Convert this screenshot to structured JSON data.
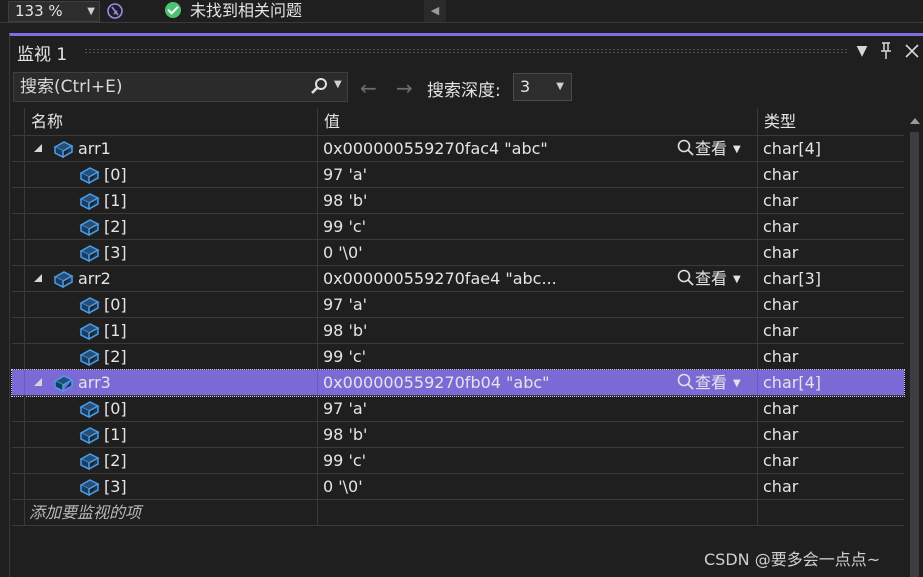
{
  "topbar": {
    "zoom": "133 %",
    "issues_text": "未找到相关问题"
  },
  "panel": {
    "title": "监视 1"
  },
  "toolbar": {
    "search_placeholder": "搜索(Ctrl+E)",
    "depth_label": "搜索深度:",
    "depth_value": "3"
  },
  "columns": {
    "name": "名称",
    "value": "值",
    "type": "类型"
  },
  "rows": [
    {
      "name": "arr1",
      "value": "0x000000559270fac4 \"abc\"",
      "type": "char[4]",
      "viewer": "查看"
    },
    {
      "name": "[0]",
      "value": "97 'a'",
      "type": "char"
    },
    {
      "name": "[1]",
      "value": "98 'b'",
      "type": "char"
    },
    {
      "name": "[2]",
      "value": "99 'c'",
      "type": "char"
    },
    {
      "name": "[3]",
      "value": "0 '\\0'",
      "type": "char"
    },
    {
      "name": "arr2",
      "value": "0x000000559270fae4 \"abc...",
      "type": "char[3]",
      "viewer": "查看"
    },
    {
      "name": "[0]",
      "value": "97 'a'",
      "type": "char"
    },
    {
      "name": "[1]",
      "value": "98 'b'",
      "type": "char"
    },
    {
      "name": "[2]",
      "value": "99 'c'",
      "type": "char"
    },
    {
      "name": "arr3",
      "value": "0x000000559270fb04 \"abc\"",
      "type": "char[4]",
      "viewer": "查看"
    },
    {
      "name": "[0]",
      "value": "97 'a'",
      "type": "char"
    },
    {
      "name": "[1]",
      "value": "98 'b'",
      "type": "char"
    },
    {
      "name": "[2]",
      "value": "99 'c'",
      "type": "char"
    },
    {
      "name": "[3]",
      "value": "0 '\\0'",
      "type": "char"
    }
  ],
  "add_item": "添加要监视的项",
  "watermark": "CSDN @要多会一点点~",
  "colors": {
    "accent": "#7f6ee0",
    "selection": "#7b6ad6",
    "object_icon": "#4a9ee8",
    "ok": "#4ec274"
  }
}
